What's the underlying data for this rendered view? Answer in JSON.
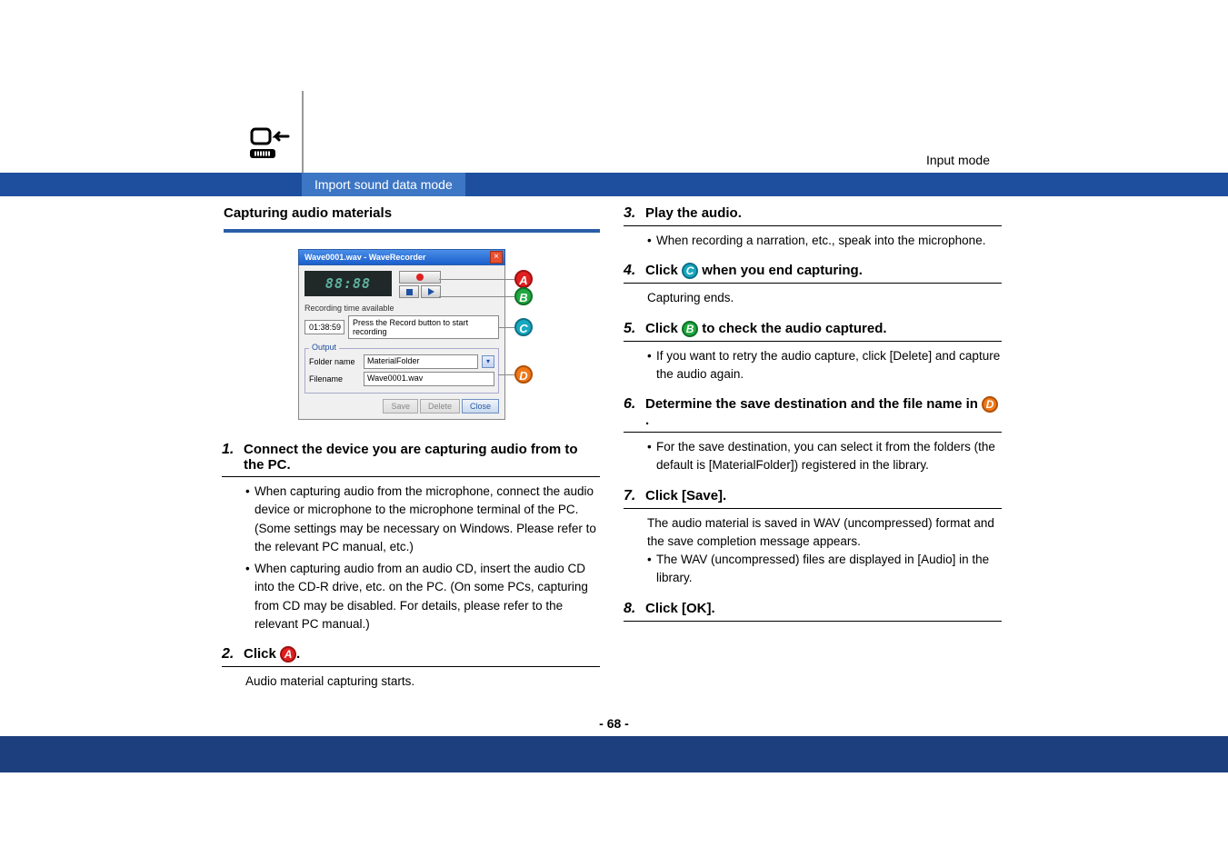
{
  "header": {
    "mode_label": "Input mode",
    "subheader": "Import sound data mode"
  },
  "section": {
    "title": "Capturing audio materials"
  },
  "window": {
    "title": "Wave0001.wav - WaveRecorder",
    "digital_time": "88:88",
    "rec_time_label": "Recording time available",
    "time_value": "01:38:59",
    "status_msg": "Press the Record button to start recording",
    "output_legend": "Output",
    "folder_label": "Folder name",
    "folder_value": "MaterialFolder",
    "file_label": "Filename",
    "file_value": "Wave0001.wav",
    "save_btn": "Save",
    "delete_btn": "Delete",
    "close_btn": "Close"
  },
  "callouts": {
    "A": "A",
    "B": "B",
    "C": "C",
    "D": "D"
  },
  "steps_left": [
    {
      "num": "1.",
      "title": "Connect the device you are capturing audio from to the PC.",
      "bullets": [
        "When capturing audio from the microphone, connect the audio device or microphone to the microphone terminal of the PC. (Some settings may be necessary on Windows. Please refer to the relevant PC manual, etc.)",
        "When capturing audio from an audio CD, insert the audio CD into the CD-R drive, etc. on the PC. (On some PCs, capturing from CD may be disabled. For details, please refer to the relevant PC manual.)"
      ]
    },
    {
      "num": "2.",
      "title_pre": "Click ",
      "circle": "A",
      "circle_class": "red",
      "title_post": ".",
      "body_text": "Audio material capturing starts."
    }
  ],
  "steps_right": [
    {
      "num": "3.",
      "title": "Play the audio.",
      "bullets": [
        "When recording a narration, etc., speak into the microphone."
      ]
    },
    {
      "num": "4.",
      "title_pre": "Click ",
      "circle": "C",
      "circle_class": "cyan",
      "title_post": " when you end capturing.",
      "body_text": "Capturing ends."
    },
    {
      "num": "5.",
      "title_pre": "Click ",
      "circle": "B",
      "circle_class": "green",
      "title_post": " to check the audio captured.",
      "bullets": [
        "If you want to retry the audio capture, click [Delete] and capture the audio again."
      ]
    },
    {
      "num": "6.",
      "title_pre": "Determine the save destination and the file name in ",
      "circle": "D",
      "circle_class": "orange",
      "title_post": ".",
      "bullets": [
        "For the save destination, you can select it from the folders (the default is [MaterialFolder]) registered in the library."
      ]
    },
    {
      "num": "7.",
      "title": "Click [Save].",
      "body_text": "The audio material is saved in WAV (uncompressed) format and the save completion message appears.",
      "bullets": [
        "The WAV (uncompressed) files are displayed in [Audio] in the library."
      ]
    },
    {
      "num": "8.",
      "title": "Click [OK]."
    }
  ],
  "page_number": "- 68 -"
}
